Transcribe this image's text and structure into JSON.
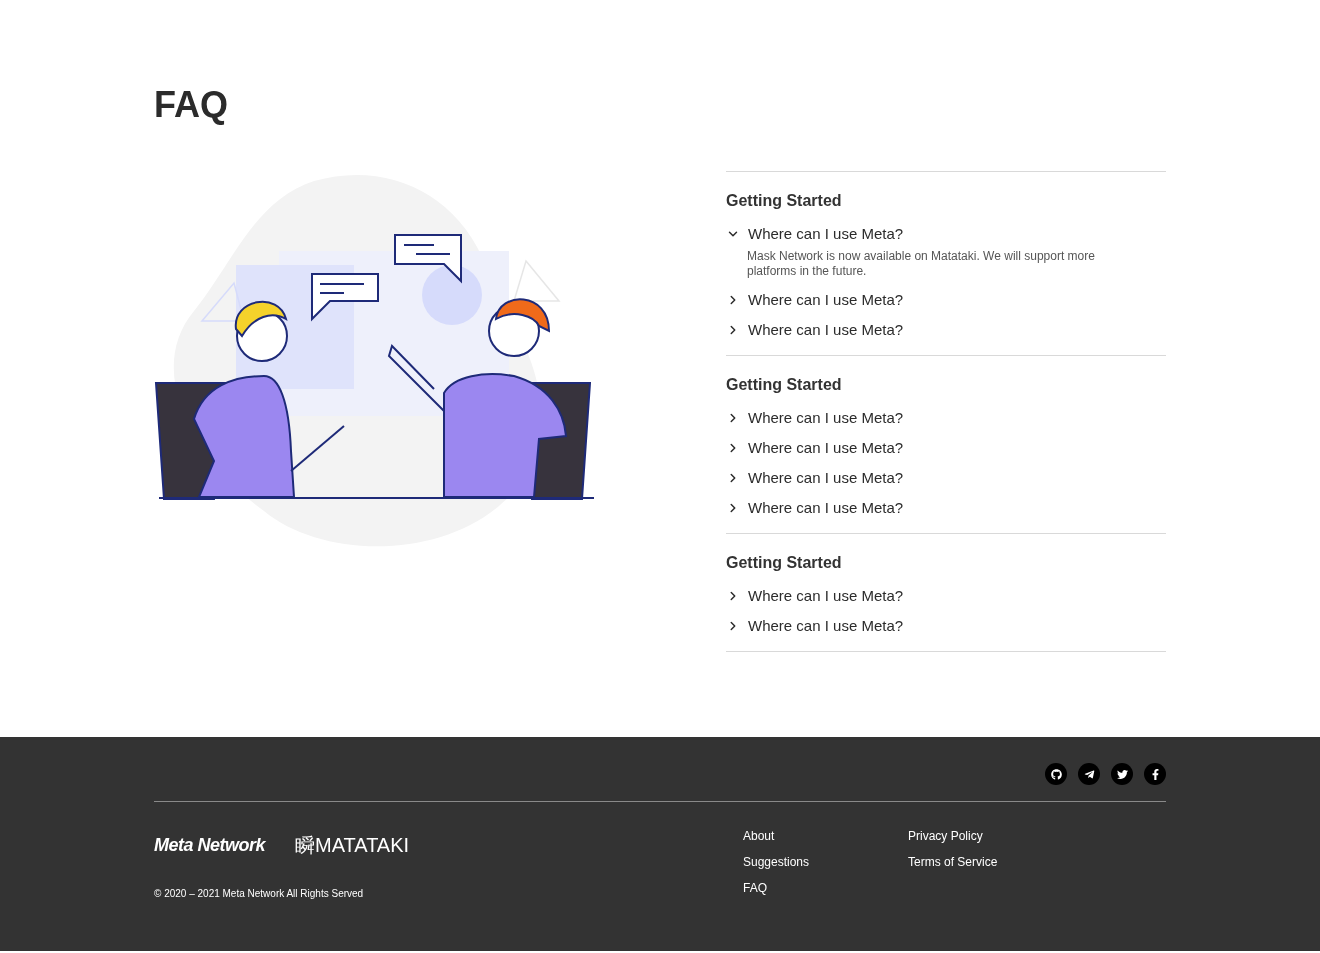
{
  "title": "FAQ",
  "sections": [
    {
      "heading": "Getting Started",
      "questions": [
        {
          "question": "Where can I use Meta?",
          "expanded": true,
          "answer": "Mask Network is now available on Matataki. We will support more platforms in the future."
        },
        {
          "question": "Where can I use Meta?",
          "expanded": false
        },
        {
          "question": "Where can I use Meta?",
          "expanded": false
        }
      ]
    },
    {
      "heading": "Getting Started",
      "questions": [
        {
          "question": "Where can I use Meta?",
          "expanded": false
        },
        {
          "question": "Where can I use Meta?",
          "expanded": false
        },
        {
          "question": "Where can I use Meta?",
          "expanded": false
        },
        {
          "question": "Where can I use Meta?",
          "expanded": false
        }
      ]
    },
    {
      "heading": "Getting Started",
      "questions": [
        {
          "question": "Where can I use Meta?",
          "expanded": false
        },
        {
          "question": "Where can I use Meta?",
          "expanded": false
        }
      ]
    }
  ],
  "footer": {
    "social": [
      {
        "kind": "github"
      },
      {
        "kind": "telegram"
      },
      {
        "kind": "twitter"
      },
      {
        "kind": "facebook"
      }
    ],
    "logos": [
      {
        "kind": "meta",
        "text": "Meta Network"
      },
      {
        "kind": "matataki",
        "text": "瞬MATATAKI"
      }
    ],
    "link_columns": [
      [
        "About",
        "Suggestions",
        "FAQ"
      ],
      [
        "Privacy Policy",
        "Terms of Service"
      ]
    ],
    "copyright": "© 2020 – 2021 Meta Network All Rights Served"
  }
}
